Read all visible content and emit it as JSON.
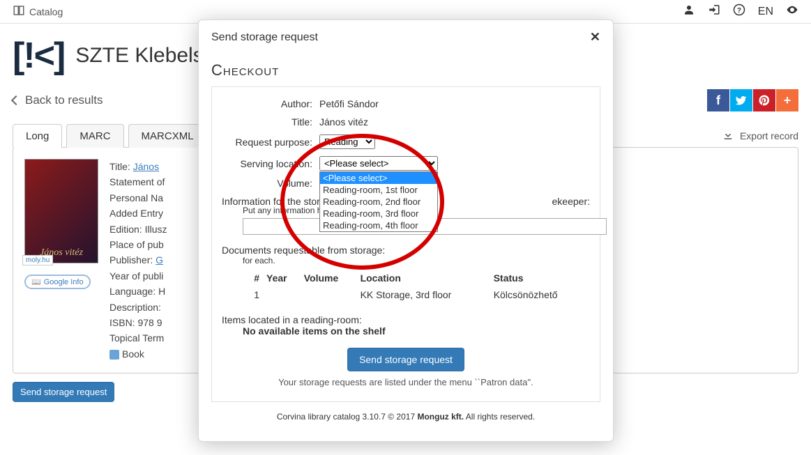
{
  "topbar": {
    "catalog": "Catalog",
    "lang": "EN"
  },
  "sitename": "SZTE Klebels",
  "back": "Back to results",
  "socials": {
    "fb": "f",
    "tw": "t",
    "pi": "p",
    "pl": "+"
  },
  "tabs": {
    "long": "Long",
    "marc": "MARC",
    "marcxml": "MARCXML",
    "export": "Export record"
  },
  "thumb": {
    "title": "János vitéz",
    "moly": "moly.hu"
  },
  "meta": {
    "title_lbl": "Title:",
    "title_val": "János",
    "l2": "Statement of",
    "l3": "Personal Na",
    "l4": "Added Entry",
    "l5": "Edition: Illusz",
    "l6": "Place of pub",
    "l7_lbl": "Publisher:",
    "l7_val": "G",
    "l8": "Year of publi",
    "l9": "Language: H",
    "l10": "Description:",
    "l11": "ISBN: 978 9",
    "l12": "Topical Term",
    "book": "Book"
  },
  "googleinfo": "Google Info",
  "storage_button": "Send storage request",
  "modal": {
    "title": "Send storage request",
    "checkout": "Checkout",
    "author_lbl": "Author:",
    "author_val": "Petőfi Sándor",
    "title_lbl": "Title:",
    "title_val": "János vitéz",
    "purpose_lbl": "Request purpose:",
    "purpose_val": "Reading",
    "location_lbl": "Serving location:",
    "location_val": "<Please select>",
    "location_opts": [
      "<Please select>",
      "Reading-room, 1st floor",
      "Reading-room, 2nd floor",
      "Reading-room, 3rd floor",
      "Reading-room, 4th floor"
    ],
    "volume_lbl": "Volume:",
    "info_lbl": "Information for the stor",
    "info_hint": "Put any information h",
    "info_hint_tail": "ekeeper:",
    "docs_title": "Documents requestable from storage:",
    "docs_sub": "for each.",
    "docs_headers": {
      "num": "#",
      "year": "Year",
      "volume": "Volume",
      "location": "Location",
      "status": "Status"
    },
    "docs_rows": [
      {
        "num": "1",
        "year": "",
        "volume": "",
        "location": "KK Storage, 3rd floor",
        "status": "Kölcsönözhető"
      }
    ],
    "shelf_title": "Items located in a reading-room:",
    "shelf_none": "No available items on the shelf",
    "send": "Send storage request",
    "listed_hint": "Your storage requests are listed under the menu ``Patron data''."
  },
  "footer": {
    "pre": "Corvina library catalog 3.10.7 © 2017 ",
    "co": "Monguz kft.",
    "post": " All rights reserved."
  }
}
